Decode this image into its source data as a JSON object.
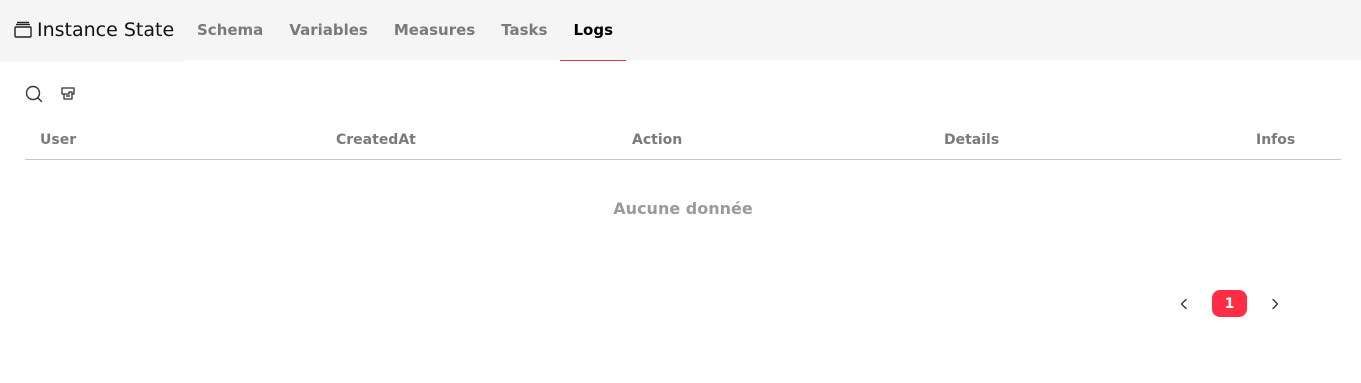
{
  "header": {
    "title": "Instance State",
    "title_icon": "window-stack-icon"
  },
  "tabs": [
    {
      "label": "Schema",
      "active": false
    },
    {
      "label": "Variables",
      "active": false
    },
    {
      "label": "Measures",
      "active": false
    },
    {
      "label": "Tasks",
      "active": false
    },
    {
      "label": "Logs",
      "active": true
    }
  ],
  "toolbar": {
    "icons": [
      "search-icon",
      "filter-clear-icon"
    ]
  },
  "table": {
    "columns": [
      "User",
      "CreatedAt",
      "Action",
      "Details",
      "Infos"
    ],
    "rows": [],
    "empty_text": "Aucune donnée"
  },
  "pagination": {
    "current_page": "1"
  },
  "colors": {
    "accent": "#ff2d46",
    "tab_underline": "#e53935",
    "header_bg": "#f5f5f5"
  }
}
